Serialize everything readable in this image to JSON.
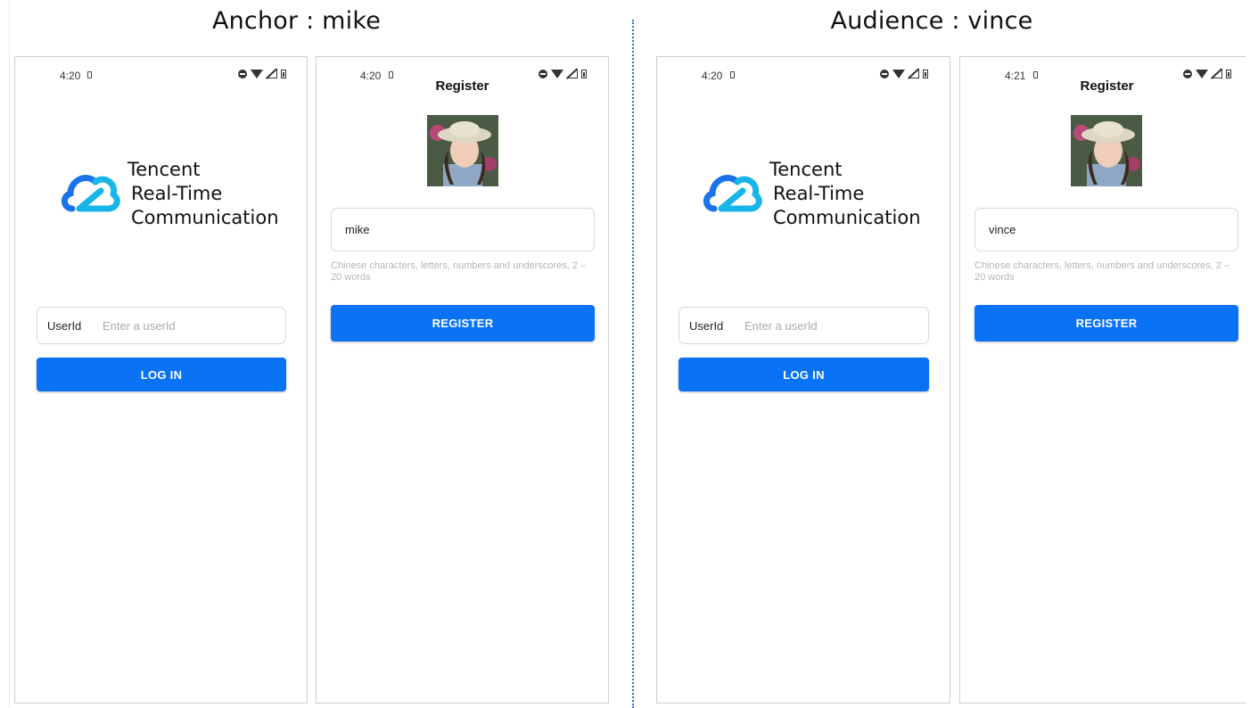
{
  "anchor": {
    "heading": "Anchor : mike",
    "login_screen": {
      "status_time": "4:20",
      "brand_lines": [
        "Tencent",
        "Real-Time",
        "Communication"
      ],
      "userid_label": "UserId",
      "userid_placeholder": "Enter a userId",
      "login_label": "LOG IN"
    },
    "register_screen": {
      "status_time": "4:20",
      "title": "Register",
      "name_value": "mike",
      "hint": "Chinese characters, letters, numbers and underscores, 2 – 20 words",
      "register_label": "REGISTER"
    }
  },
  "audience": {
    "heading": "Audience : vince",
    "login_screen": {
      "status_time": "4:20",
      "brand_lines": [
        "Tencent",
        "Real-Time",
        "Communication"
      ],
      "userid_label": "UserId",
      "userid_placeholder": "Enter a userId",
      "login_label": "LOG IN"
    },
    "register_screen": {
      "status_time": "4:21",
      "title": "Register",
      "name_value": "vince",
      "hint": "Chinese characters, letters, numbers and underscores, 2 – 20 words",
      "register_label": "REGISTER"
    }
  },
  "colors": {
    "primary": "#0a72f5",
    "divider": "#2f6fb8",
    "logo_blue": "#1a73e8",
    "logo_cyan": "#19b5e8"
  }
}
